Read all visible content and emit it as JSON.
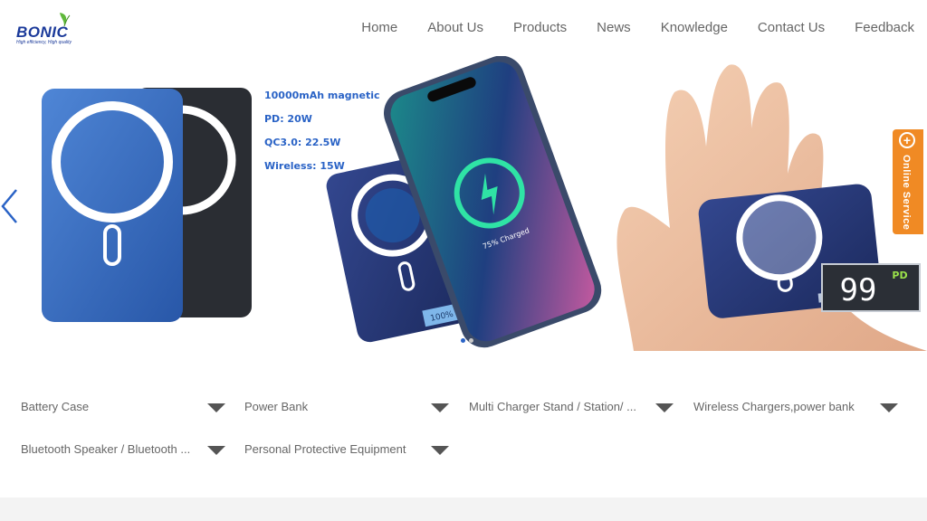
{
  "brand": {
    "name": "BONIC",
    "tagline": "High efficiency, High quality"
  },
  "nav": {
    "items": [
      {
        "label": "Home"
      },
      {
        "label": "About Us"
      },
      {
        "label": "Products"
      },
      {
        "label": "News"
      },
      {
        "label": "Knowledge"
      },
      {
        "label": "Contact Us"
      },
      {
        "label": "Feedback"
      }
    ]
  },
  "banner": {
    "specs": [
      "10000mAh magnetic",
      "PD: 20W",
      "QC3.0: 22.5W",
      "Wireless: 15W"
    ],
    "phone_screen_text": "75% Charged",
    "bank_display_text": "100%",
    "hand_display_value": "99",
    "hand_display_badge": "PD",
    "small_display_value": "99",
    "slide_count": 2,
    "active_slide": 1
  },
  "online_service": {
    "label": "Online Service",
    "icon": "plus-icon"
  },
  "categories": [
    {
      "label": "Battery Case"
    },
    {
      "label": "Power Bank"
    },
    {
      "label": "Multi Charger Stand / Station/ ..."
    },
    {
      "label": "Wireless Chargers,power bank"
    },
    {
      "label": "Bluetooth Speaker / Bluetooth ..."
    },
    {
      "label": "Personal Protective Equipment"
    }
  ],
  "colors": {
    "brand_blue": "#1b3a9a",
    "spec_blue": "#2a63c6",
    "service_orange": "#f08a24",
    "leaf_green": "#5fb83a"
  }
}
